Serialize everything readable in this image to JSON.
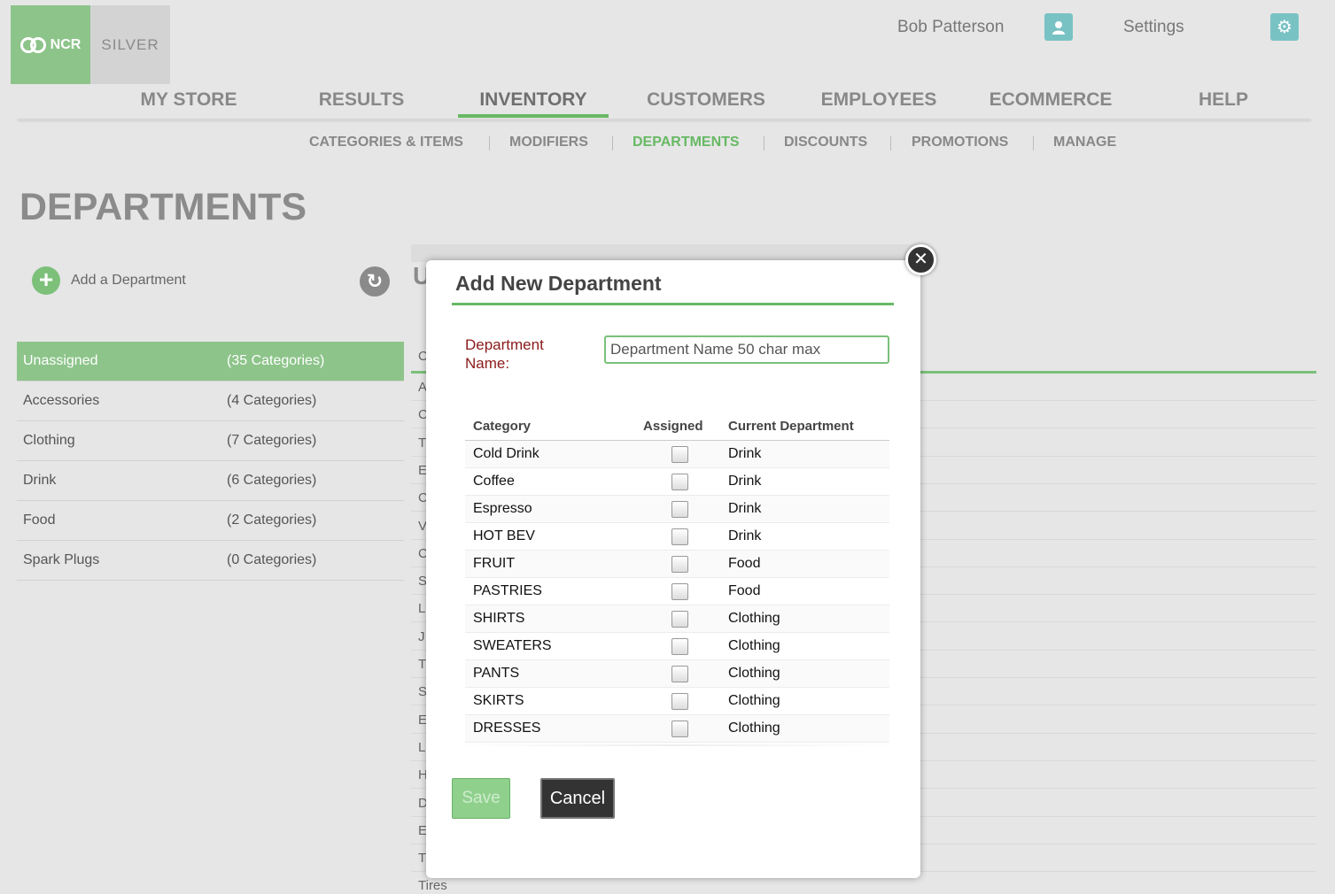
{
  "header": {
    "logo_ncr": "NCR",
    "logo_silver": "SILVER",
    "user_name": "Bob Patterson",
    "settings_label": "Settings"
  },
  "main_nav": [
    {
      "label": "MY STORE",
      "active": false
    },
    {
      "label": "RESULTS",
      "active": false
    },
    {
      "label": "INVENTORY",
      "active": true
    },
    {
      "label": "CUSTOMERS",
      "active": false
    },
    {
      "label": "EMPLOYEES",
      "active": false
    },
    {
      "label": "ECOMMERCE",
      "active": false
    },
    {
      "label": "HELP",
      "active": false
    }
  ],
  "sub_nav": [
    {
      "label": "CATEGORIES & ITEMS",
      "active": false
    },
    {
      "label": "MODIFIERS",
      "active": false
    },
    {
      "label": "DEPARTMENTS",
      "active": true
    },
    {
      "label": "DISCOUNTS",
      "active": false
    },
    {
      "label": "PROMOTIONS",
      "active": false
    },
    {
      "label": "MANAGE",
      "active": false
    }
  ],
  "page": {
    "title": "DEPARTMENTS",
    "add_department_label": "Add a Department"
  },
  "departments": [
    {
      "name": "Unassigned",
      "count": "(35 Categories)",
      "selected": true
    },
    {
      "name": "Accessories",
      "count": "(4 Categories)",
      "selected": false
    },
    {
      "name": "Clothing",
      "count": "(7 Categories)",
      "selected": false
    },
    {
      "name": "Drink",
      "count": "(6 Categories)",
      "selected": false
    },
    {
      "name": "Food",
      "count": "(2 Categories)",
      "selected": false
    },
    {
      "name": "Spark Plugs",
      "count": "(0 Categories)",
      "selected": false
    }
  ],
  "background_panel": {
    "title_fragment": "U",
    "header_fragment": "C",
    "row_fragments": [
      "A",
      "C",
      "T",
      "E",
      "C",
      "V",
      "C",
      "S",
      "L",
      "J",
      "T",
      "S",
      "E",
      "L",
      "H",
      "D",
      "E",
      "T"
    ],
    "last_row": "Tires"
  },
  "modal": {
    "title": "Add New Department",
    "field_label": "Department Name:",
    "input_placeholder": "Department Name 50 char max",
    "input_value": "",
    "columns": {
      "category": "Category",
      "assigned": "Assigned",
      "current_department": "Current Department"
    },
    "rows": [
      {
        "category": "Cold Drink",
        "assigned": false,
        "department": "Drink"
      },
      {
        "category": "Coffee",
        "assigned": false,
        "department": "Drink"
      },
      {
        "category": "Espresso",
        "assigned": false,
        "department": "Drink"
      },
      {
        "category": "HOT BEV",
        "assigned": false,
        "department": "Drink"
      },
      {
        "category": "FRUIT",
        "assigned": false,
        "department": "Food"
      },
      {
        "category": "PASTRIES",
        "assigned": false,
        "department": "Food"
      },
      {
        "category": "SHIRTS",
        "assigned": false,
        "department": "Clothing"
      },
      {
        "category": "SWEATERS",
        "assigned": false,
        "department": "Clothing"
      },
      {
        "category": "PANTS",
        "assigned": false,
        "department": "Clothing"
      },
      {
        "category": "SKIRTS",
        "assigned": false,
        "department": "Clothing"
      },
      {
        "category": "DRESSES",
        "assigned": false,
        "department": "Clothing"
      }
    ],
    "save_label": "Save",
    "cancel_label": "Cancel"
  },
  "icons": {
    "user": "user-icon",
    "settings": "gear-icon",
    "add": "plus-circle-icon",
    "refresh": "refresh-icon",
    "close": "close-icon"
  },
  "colors": {
    "accent_green": "#67b964",
    "selected_row": "#8dc48a",
    "icon_teal": "#79c2c4",
    "label_red": "#8b1a1a"
  }
}
